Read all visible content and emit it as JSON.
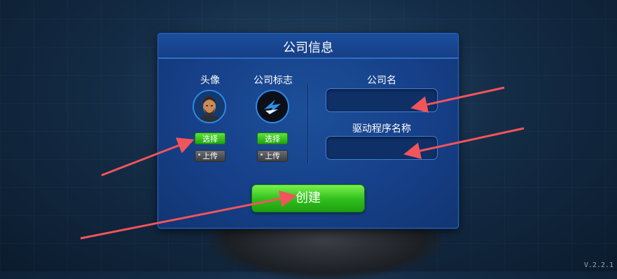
{
  "panel": {
    "title": "公司信息"
  },
  "avatar": {
    "label": "头像",
    "select_label": "选择",
    "upload_label": "上传"
  },
  "logo": {
    "label": "公司标志",
    "select_label": "选择",
    "upload_label": "上传"
  },
  "company_name": {
    "label": "公司名",
    "value": ""
  },
  "driver_program_name": {
    "label": "驱动程序名称",
    "value": ""
  },
  "create_button": {
    "label": "创建"
  },
  "version": "V.2.2.1",
  "colors": {
    "panel": "#164089",
    "accent_green": "#2fbe1b",
    "arrow_red": "#f2545b"
  }
}
